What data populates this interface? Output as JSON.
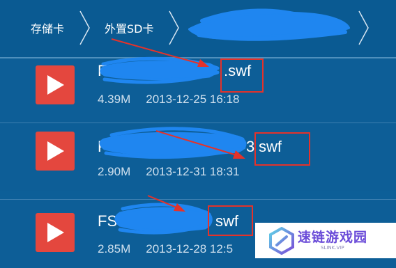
{
  "breadcrumb": {
    "items": [
      {
        "label": "存储卡"
      },
      {
        "label": "外置SD卡"
      }
    ]
  },
  "files": [
    {
      "name_visible": ".swf",
      "size": "4.39M",
      "date": "2013-12-25 16:18"
    },
    {
      "name_visible": "swf",
      "size": "2.90M",
      "date": "2013-12-31 18:31"
    },
    {
      "name_visible": "swf",
      "size": "2.85M",
      "date": "2013-12-28 12:5"
    }
  ],
  "partial_text": {
    "row1_prefix": "F",
    "row2_prefix": "F",
    "row2_before_ext": "3",
    "row3_prefix": "FS"
  },
  "watermark": {
    "title": "速链游戏园",
    "subtitle": "SLINK.VIP"
  },
  "colors": {
    "background": "#0d5f98",
    "play_button": "#e4473e",
    "annotation_red": "#e5322a",
    "redaction_blue": "#1f86f0",
    "watermark_purple": "#6a4bd8"
  },
  "icons": [
    "chevron-right-icon",
    "play-icon",
    "watermark-logo-icon"
  ]
}
